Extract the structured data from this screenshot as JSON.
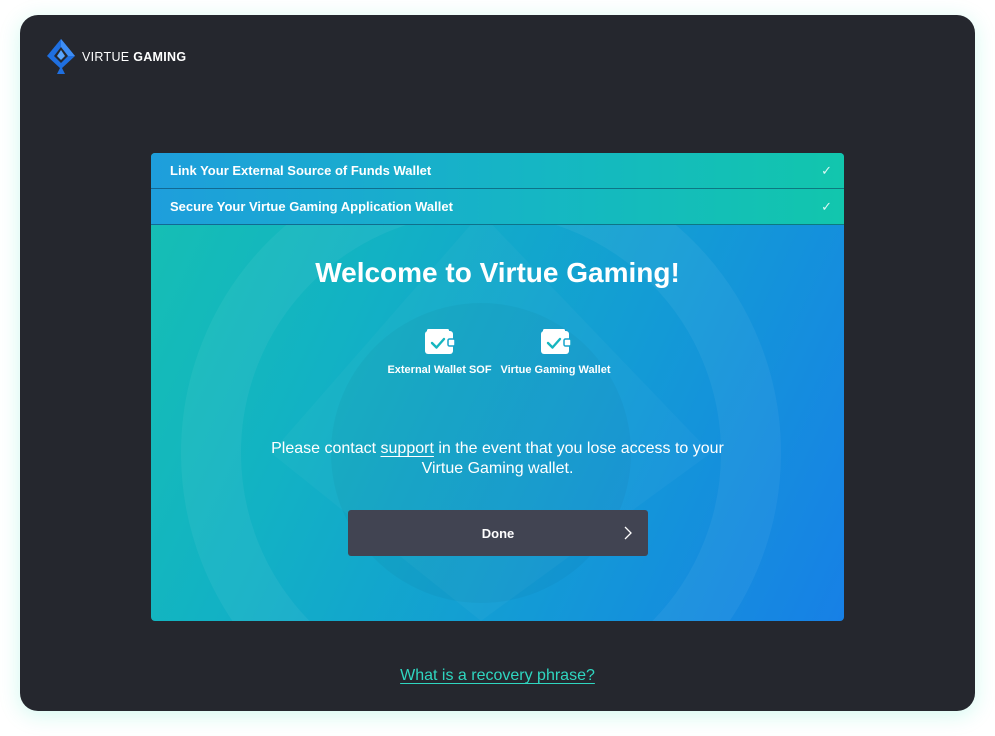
{
  "brand": {
    "name_light": "VIRTUE ",
    "name_bold": "GAMING"
  },
  "steps": [
    {
      "label": "Link Your External Source of Funds Wallet",
      "check": "✓"
    },
    {
      "label": "Secure Your Virtue Gaming Application Wallet",
      "check": "✓"
    }
  ],
  "main": {
    "title": "Welcome to Virtue Gaming!",
    "wallets": [
      {
        "label": "External Wallet SOF",
        "icon": "wallet-check-icon"
      },
      {
        "label": "Virtue Gaming Wallet",
        "icon": "wallet-check-icon"
      }
    ],
    "contact_before": "Please contact ",
    "contact_link": "support",
    "contact_after_line1": " in the event that you lose access to your",
    "contact_line2": "Virtue Gaming wallet.",
    "done_label": "Done"
  },
  "footer": {
    "recovery_link": "What is a recovery phrase?"
  },
  "colors": {
    "window_bg": "#25272e",
    "card_gradient_start": "#16c0b2",
    "card_gradient_end": "#1780e6",
    "button_bg": "#414452",
    "link_accent": "#2fd6c0"
  }
}
